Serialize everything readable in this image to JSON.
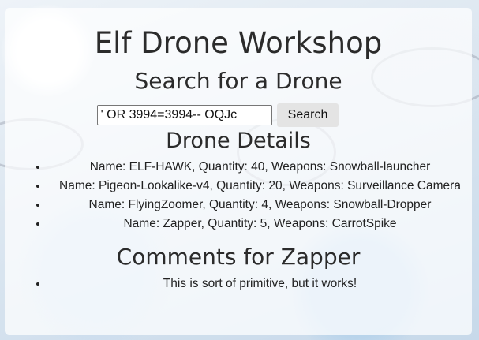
{
  "page": {
    "title": "Elf Drone Workshop"
  },
  "search": {
    "heading": "Search for a Drone",
    "input_value": "' OR 3994=3994-- OQJc",
    "button_label": "Search"
  },
  "details": {
    "heading": "Drone Details",
    "items": [
      "Name: ELF-HAWK, Quantity: 40, Weapons: Snowball-launcher",
      "Name: Pigeon-Lookalike-v4, Quantity: 20, Weapons: Surveillance Camera",
      "Name: FlyingZoomer, Quantity: 4, Weapons: Snowball-Dropper",
      "Name: Zapper, Quantity: 5, Weapons: CarrotSpike"
    ]
  },
  "comments": {
    "heading": "Comments for Zapper",
    "items": [
      "This is sort of primitive, but it works!"
    ]
  }
}
